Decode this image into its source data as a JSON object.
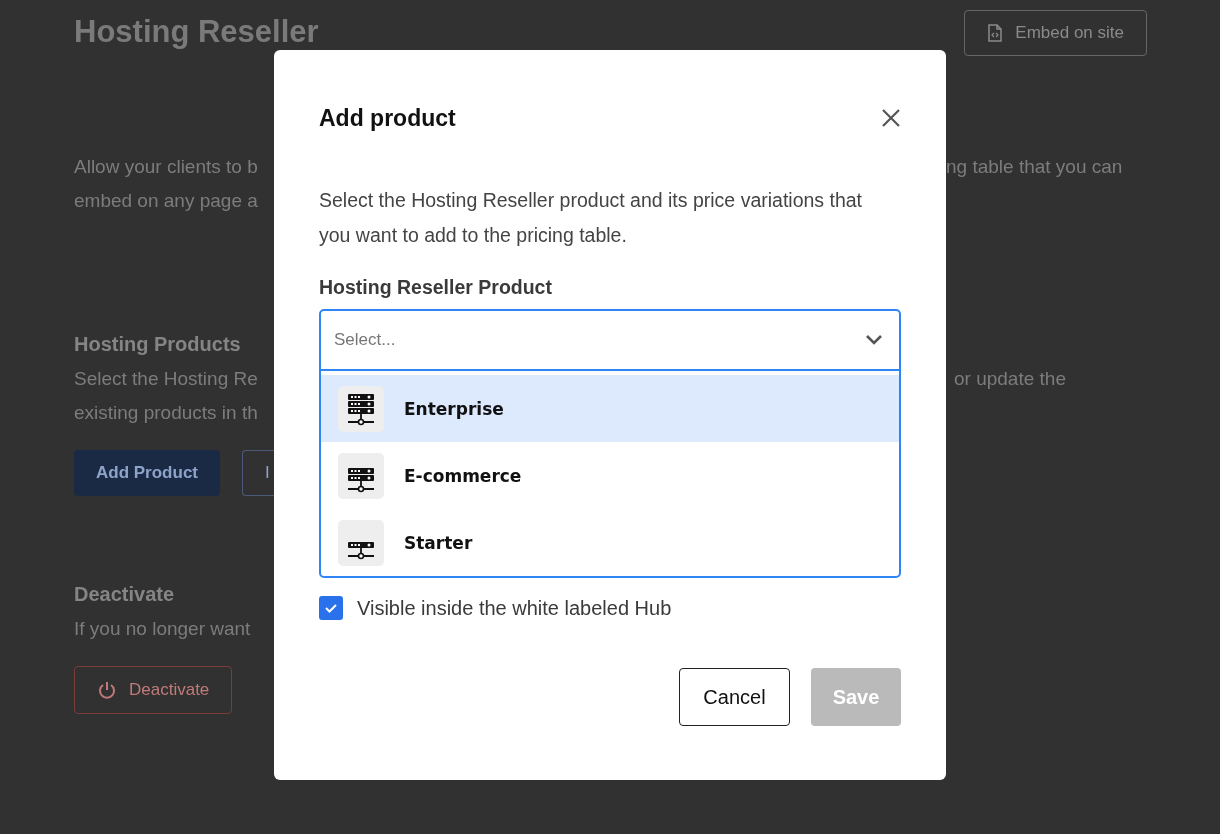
{
  "page": {
    "title": "Hosting Reseller",
    "embed_button": "Embed on site",
    "intro": {
      "left_lines": [
        "Allow your clients to b",
        "embed on any page a"
      ],
      "right_lines": [
        "ng table that you can"
      ]
    },
    "products_section": {
      "heading": "Hosting Products",
      "left_lines": [
        "Select the Hosting Re",
        "existing products in th"
      ],
      "right_lines": [
        "or update the"
      ],
      "add_button": "Add Product",
      "second_button": "I"
    },
    "deactivate_section": {
      "heading": "Deactivate",
      "left_lines": [
        "If you no longer want"
      ],
      "button": "Deactivate"
    }
  },
  "dialog": {
    "title": "Add product",
    "description": "Select the Hosting Reseller product and its price variations that you want to add to the pricing table.",
    "field_label": "Hosting Reseller Product",
    "select": {
      "placeholder": "Select...",
      "expanded": true,
      "options": [
        {
          "label": "Enterprise",
          "selected": true,
          "kind": "large"
        },
        {
          "label": "E-commerce",
          "selected": false,
          "kind": "medium"
        },
        {
          "label": "Starter",
          "selected": false,
          "kind": "small"
        }
      ]
    },
    "checkbox": {
      "label": "Visible inside the white labeled Hub",
      "checked": true
    },
    "buttons": {
      "cancel": "Cancel",
      "save": "Save",
      "save_disabled": true
    }
  }
}
